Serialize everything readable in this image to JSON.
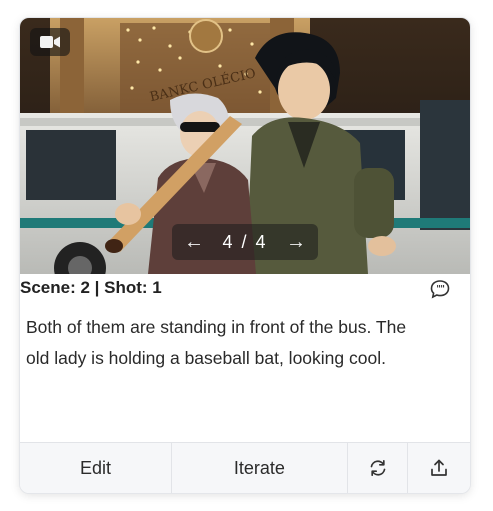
{
  "media": {
    "type_icon": "video-camera-icon",
    "pager": {
      "prev_icon": "arrow-left-icon",
      "counter": "4 / 4",
      "next_icon": "arrow-right-icon"
    },
    "sign_text": "BANKC OLÉCIO"
  },
  "shot": {
    "title": "Scene: 2 | Shot: 1",
    "comment_icon": "speech-bubble-icon",
    "description": "Both of them are standing in front of the bus. The old lady is holding a baseball bat, looking cool."
  },
  "actions": {
    "edit_label": "Edit",
    "iterate_label": "Iterate",
    "regenerate_icon": "refresh-icon",
    "share_icon": "upload-share-icon"
  },
  "colors": {
    "card_border": "#e4e6ea",
    "footer_bg": "#f6f7f9",
    "text_primary": "#222222"
  }
}
